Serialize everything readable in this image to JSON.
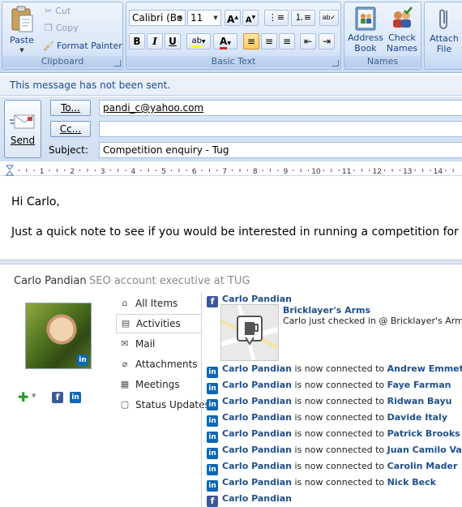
{
  "ribbon": {
    "clipboard": {
      "paste_label": "Paste",
      "cut_label": "Cut",
      "copy_label": "Copy",
      "format_painter_label": "Format Painter",
      "group_label": "Clipboard"
    },
    "basic_text": {
      "font_name": "Calibri (Bo",
      "font_size": "11",
      "grow_font": "A",
      "shrink_font": "A",
      "bold": "B",
      "italic": "I",
      "underline": "U",
      "highlight": "ab",
      "font_color": "A",
      "group_label": "Basic Text"
    },
    "names": {
      "address_book_label": "Address Book",
      "check_names_label": "Check Names",
      "group_label": "Names"
    },
    "include": {
      "attach_file_label": "Attach File"
    }
  },
  "infobar": {
    "text": "This message has not been sent."
  },
  "compose": {
    "send_label": "Send",
    "to_button": "To...",
    "cc_button": "Cc...",
    "subject_label": "Subject:",
    "to_value": "pandi_c@yahoo.com",
    "cc_value": "",
    "subject_value": "Competition enquiry - Tug"
  },
  "ruler": {
    "numbers": [
      "1",
      "2",
      "3",
      "4",
      "5",
      "6",
      "7",
      "8",
      "9",
      "10",
      "11",
      "12",
      "13",
      "14"
    ]
  },
  "message": {
    "greeting": "Hi Carlo,",
    "line1": "Just a quick note to see if you would be interested in running a competition for Tug"
  },
  "social": {
    "person_name": "Carlo Pandian",
    "person_title": "SEO account executive at TUG",
    "nav": [
      {
        "label": "All Items",
        "icon": "all-items-icon"
      },
      {
        "label": "Activities",
        "icon": "activities-icon"
      },
      {
        "label": "Mail",
        "icon": "mail-icon"
      },
      {
        "label": "Attachments",
        "icon": "paperclip-icon"
      },
      {
        "label": "Meetings",
        "icon": "calendar-icon"
      },
      {
        "label": "Status Updates",
        "icon": "status-updates-icon"
      }
    ],
    "activities": {
      "top_name": "Carlo Pandian",
      "checkin_place": "Bricklayer's Arms",
      "checkin_text": "Carlo just checked in @ Bricklayer's Arms (S",
      "connector_text": "is now connected to",
      "connections": [
        {
          "name": "Carlo Pandian",
          "contact": "Andrew Emmett"
        },
        {
          "name": "Carlo Pandian",
          "contact": "Faye Farman"
        },
        {
          "name": "Carlo Pandian",
          "contact": "Ridwan Bayu"
        },
        {
          "name": "Carlo Pandian",
          "contact": "Davide Italy"
        },
        {
          "name": "Carlo Pandian",
          "contact": "Patrick Brooks"
        },
        {
          "name": "Carlo Pandian",
          "contact": "Juan Camilo Vargas"
        },
        {
          "name": "Carlo Pandian",
          "contact": "Carolin Mader"
        },
        {
          "name": "Carlo Pandian",
          "contact": "Nick Beck"
        }
      ],
      "bottom_name": "Carlo Pandian"
    },
    "icons": {
      "facebook": "f",
      "linkedin": "in"
    }
  },
  "colors": {
    "ribbon_bg": "#c9dbf2",
    "link_blue": "#1f4f8c",
    "linkedin_blue": "#0c68b4",
    "facebook_blue": "#3b5998"
  }
}
